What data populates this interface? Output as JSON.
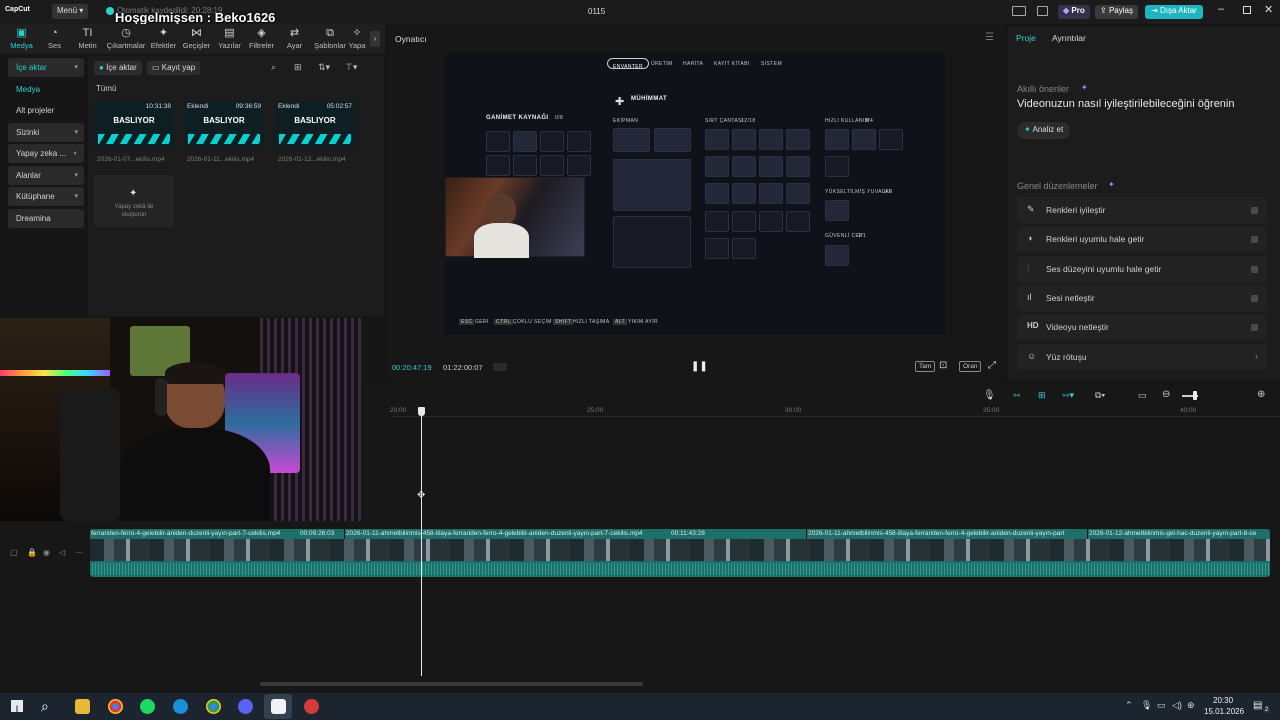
{
  "app": {
    "logo": "CapCut",
    "menu_label": "Menü",
    "autosave_text": "Otomatik kaydedildi: 20:28:19",
    "overlay_text": "Hoşgelmişsen : Beko1626",
    "project_name": "0115",
    "pro_label": "Pro",
    "share_label": "Paylaş",
    "export_label": "Dışa Aktar"
  },
  "tools": [
    {
      "label": "Medya",
      "icon": "media-icon"
    },
    {
      "label": "Ses",
      "icon": "audio-icon"
    },
    {
      "label": "Metin",
      "icon": "text-icon"
    },
    {
      "label": "Çıkartmalar",
      "icon": "sticker-icon"
    },
    {
      "label": "Efektler",
      "icon": "effects-icon"
    },
    {
      "label": "Geçişler",
      "icon": "transitions-icon"
    },
    {
      "label": "Yazılar",
      "icon": "captions-icon"
    },
    {
      "label": "Filtreler",
      "icon": "filters-icon"
    },
    {
      "label": "Ayar",
      "icon": "adjust-icon"
    },
    {
      "label": "Şablonlar",
      "icon": "templates-icon"
    },
    {
      "label": "Yapa",
      "icon": "ai-icon"
    }
  ],
  "leftnav": {
    "import": "İçe aktar",
    "media": "Medya",
    "subprojects": "Alt projeler",
    "yours": "Sizinki",
    "ai": "Yapay zeka ...",
    "spaces": "Alanlar",
    "library": "Kütüphane",
    "dreamina": "Dreamina"
  },
  "media": {
    "import_btn": "İçe aktar",
    "record_btn": "Kayıt yap",
    "filter_all": "Tümü",
    "cards": [
      {
        "label": "BASLIYOR",
        "tag": "",
        "duration": "10:31:38",
        "file": "2026-01-07...ekilis.mp4"
      },
      {
        "label": "BASLIYOR",
        "tag": "Eklendi",
        "duration": "09:36:59",
        "file": "2026-01-11...ekilis.mp4"
      },
      {
        "label": "BASLIYOR",
        "tag": "Eklendi",
        "duration": "05:02:57",
        "file": "2026-01-12...ekilis.mp4"
      }
    ],
    "ai_create": "Yapay zekâ ile oluşturun"
  },
  "player": {
    "title": "Oynatıcı",
    "current_time": "00:20:47:19",
    "total_time": "01:22:00:07",
    "full_label": "Tam",
    "ratio_label": "Oran"
  },
  "game": {
    "tabs": [
      "ENVANTER",
      "ÜRETİM",
      "HARİTA",
      "KAYIT KİTABI",
      "SİSTEM"
    ],
    "loot_title": "GANİMET KAYNAĞI",
    "loot_count": "0/8",
    "ammo_title": "MÜHİMMAT",
    "equipped": "EKİPMAN",
    "backpack": "SIRT ÇANTASI",
    "backpack_count": "12/18",
    "quick_use": "HIZLI KULLANIM",
    "quick_count": "3/4",
    "aug_slots": "YÜKSELTİLMİŞ YUVALAR",
    "aug_count": "1/1",
    "safe_pocket": "GÜVENLİ CEP",
    "safe_count": "1/1",
    "hints": [
      {
        "key": "ESC",
        "text": "GERİ"
      },
      {
        "key": "CTRL",
        "text": "ÇOKLU SEÇİM"
      },
      {
        "key": "SHIFT",
        "text": "HIZLI TAŞIMA"
      },
      {
        "key": "ALT",
        "text": "YIKIM AYIR"
      }
    ]
  },
  "inspector": {
    "tab_project": "Proje",
    "tab_details": "Ayrıntılar",
    "smart_title": "Akıllı öneriler",
    "smart_headline": "Videonuzun nasıl iyileştirilebileceğini öğrenin",
    "analyze_btn": "Analiz et",
    "general_title": "Genel düzenlemeler",
    "options": [
      {
        "label": "Renkleri iyileştir",
        "icon": "wand-icon"
      },
      {
        "label": "Renkleri uyumlu hale getir",
        "icon": "color-match-icon"
      },
      {
        "label": "Ses düzeyini uyumlu hale getir",
        "icon": "volume-match-icon"
      },
      {
        "label": "Sesi netleştir",
        "icon": "audio-clean-icon"
      },
      {
        "label": "Videoyu netleştir",
        "icon": "hd-icon"
      },
      {
        "label": "Yüz rötuşu",
        "icon": "face-retouch-icon"
      }
    ]
  },
  "timeline": {
    "ruler": [
      "20:00",
      "25:00",
      "30:00",
      "35:00",
      "40:00"
    ],
    "clips": [
      {
        "name": "ferrariden-ferro-4-gelebilir-aniden-duzenli-yayın-part-7-cekilis.mp4",
        "duration": "00:09:26:03"
      },
      {
        "name": "2026-01-11-ahmetbilinmis-458-itlaya-ferrariden-ferro-4-gelebilir-aniden-duzenli-yayın-part-7-cekilis.mp4",
        "duration": "00:11:43:28"
      },
      {
        "name": "2026-01-11-ahmetbilinmis-458-itlaya-ferrariden-ferro-4-gelebilir-aniden-duzenli-yayın-part",
        "duration": ""
      },
      {
        "name": "2026-01-12-ahmetbilinmis-gel-hac-duzenli-yayın-part-8-ce",
        "duration": ""
      }
    ]
  },
  "taskbar": {
    "time": "20:30",
    "date": "15.01.2026",
    "notification_count": "2"
  },
  "colors": {
    "accent": "#2bd2d2",
    "export_bg": "#1fb5c0",
    "clip_bg": "#1d6f6a"
  }
}
